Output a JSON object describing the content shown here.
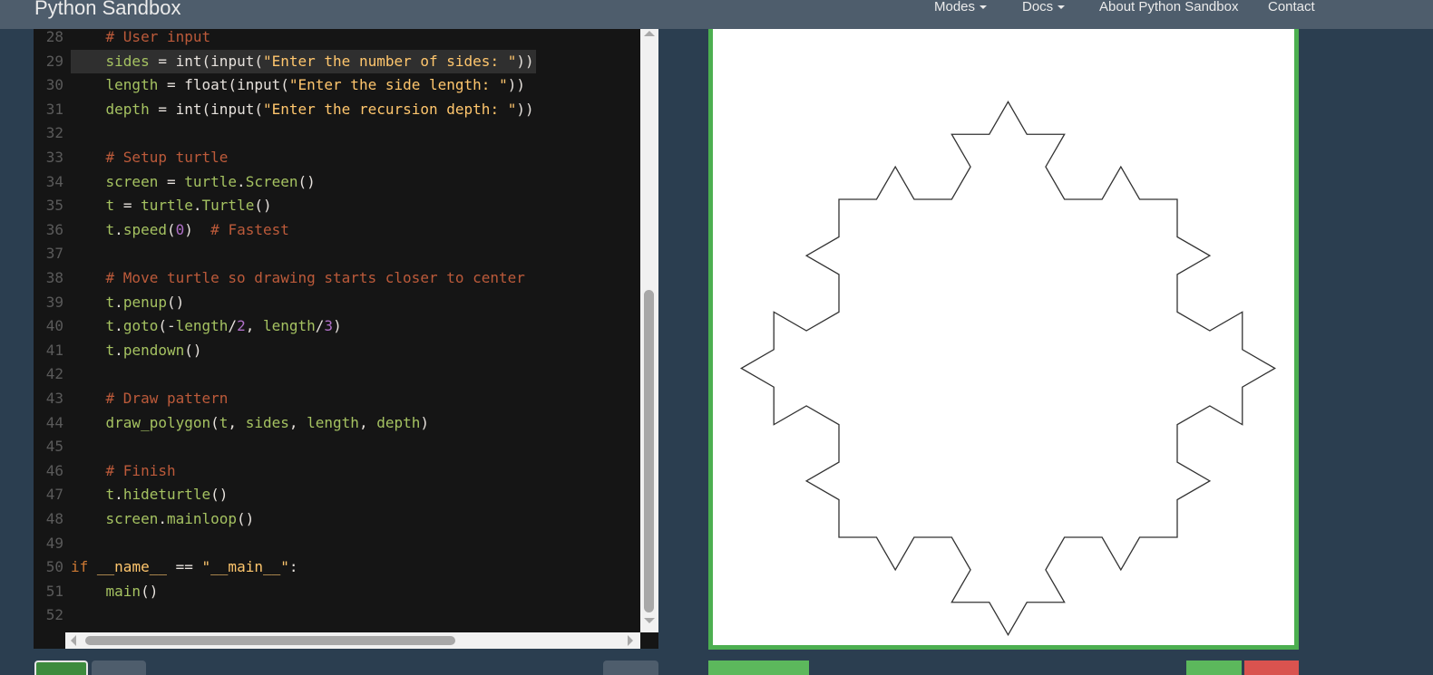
{
  "app": {
    "title": "Python Sandbox"
  },
  "nav": {
    "modes": "Modes",
    "docs": "Docs",
    "about": "About Python Sandbox",
    "contact": "Contact"
  },
  "editor": {
    "active_line": 29,
    "lines": [
      {
        "n": "28",
        "t": "    # User input"
      },
      {
        "n": "29",
        "t": "    sides = int(input(\"Enter the number of sides: \"))"
      },
      {
        "n": "30",
        "t": "    length = float(input(\"Enter the side length: \"))"
      },
      {
        "n": "31",
        "t": "    depth = int(input(\"Enter the recursion depth: \"))"
      },
      {
        "n": "32",
        "t": ""
      },
      {
        "n": "33",
        "t": "    # Setup turtle"
      },
      {
        "n": "34",
        "t": "    screen = turtle.Screen()"
      },
      {
        "n": "35",
        "t": "    t = turtle.Turtle()"
      },
      {
        "n": "36",
        "t": "    t.speed(0)  # Fastest"
      },
      {
        "n": "37",
        "t": ""
      },
      {
        "n": "38",
        "t": "    # Move turtle so drawing starts closer to center"
      },
      {
        "n": "39",
        "t": "    t.penup()"
      },
      {
        "n": "40",
        "t": "    t.goto(-length/2, length/3)"
      },
      {
        "n": "41",
        "t": "    t.pendown()"
      },
      {
        "n": "42",
        "t": ""
      },
      {
        "n": "43",
        "t": "    # Draw pattern"
      },
      {
        "n": "44",
        "t": "    draw_polygon(t, sides, length, depth)"
      },
      {
        "n": "45",
        "t": ""
      },
      {
        "n": "46",
        "t": "    # Finish"
      },
      {
        "n": "47",
        "t": "    t.hideturtle()"
      },
      {
        "n": "48",
        "t": "    screen.mainloop()"
      },
      {
        "n": "49",
        "t": ""
      },
      {
        "n": "50",
        "t": "if __name__ == \"__main__\":"
      },
      {
        "n": "51",
        "t": "    main()"
      },
      {
        "n": "52",
        "t": ""
      }
    ]
  },
  "canvas": {
    "border_color": "#4caf50",
    "fractal": {
      "sides": 4,
      "depth": 2,
      "stroke": "#333333"
    }
  },
  "colors": {
    "page_bg": "#2b3e50",
    "navbar_bg": "#4e5d6c",
    "editor_bg": "#151515",
    "green_button": "#5cb85c",
    "red_button": "#d9534f",
    "gray_button": "#4e5d6c"
  }
}
